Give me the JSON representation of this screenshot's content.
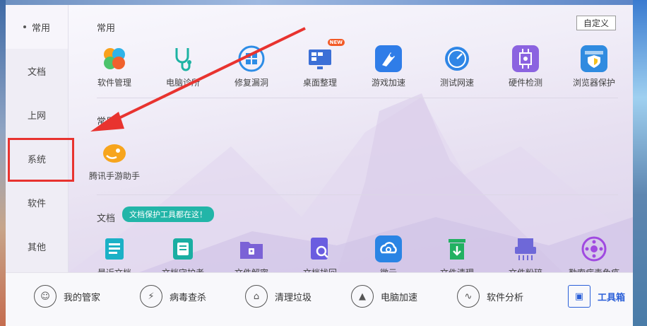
{
  "sidebar": {
    "items": [
      {
        "label": "常用"
      },
      {
        "label": "文档"
      },
      {
        "label": "上网"
      },
      {
        "label": "系统"
      },
      {
        "label": "软件"
      },
      {
        "label": "其他"
      }
    ]
  },
  "header": {
    "customize_label": "自定义"
  },
  "sections": {
    "common": {
      "title": "常用",
      "tools": [
        {
          "label": "软件管理",
          "icon": "software-manager-icon",
          "color": "#f9a11b"
        },
        {
          "label": "电脑诊所",
          "icon": "stethoscope-icon",
          "color": "#1db3a3"
        },
        {
          "label": "修复漏洞",
          "icon": "windows-repair-icon",
          "color": "#2d8de6"
        },
        {
          "label": "桌面整理",
          "icon": "desktop-organize-icon",
          "color": "#3b6fd6",
          "badge": "NEW"
        },
        {
          "label": "游戏加速",
          "icon": "game-boost-icon",
          "color": "#2f7de8"
        },
        {
          "label": "测试网速",
          "icon": "speedometer-icon",
          "color": "#2f86e6"
        },
        {
          "label": "硬件检测",
          "icon": "chip-icon",
          "color": "#8b63e0"
        },
        {
          "label": "浏览器保护",
          "icon": "browser-shield-icon",
          "color": "#2f8be0"
        }
      ]
    },
    "recent": {
      "title": "常用",
      "tools": [
        {
          "label": "腾讯手游助手",
          "icon": "tencent-game-assistant-icon",
          "color": "#f7a51d"
        }
      ]
    },
    "docs": {
      "title": "文档",
      "tooltip": "文档保护工具都在这！",
      "tools": [
        {
          "label": "最近文档",
          "icon": "recent-docs-icon",
          "color": "#1bb1c6"
        },
        {
          "label": "文档守护者",
          "icon": "doc-guardian-icon",
          "color": "#1aaea2"
        },
        {
          "label": "文件解密",
          "icon": "folder-lock-icon",
          "color": "#7b62d6"
        },
        {
          "label": "文档找回",
          "icon": "doc-search-icon",
          "color": "#6a5de0"
        },
        {
          "label": "微云",
          "icon": "weiyun-cloud-icon",
          "color": "#2a84e4"
        },
        {
          "label": "文件清理",
          "icon": "trash-bin-icon",
          "color": "#22b162"
        },
        {
          "label": "文件粉碎",
          "icon": "shredder-icon",
          "color": "#6e68d8"
        },
        {
          "label": "勒索病毒免疫",
          "icon": "virus-immune-icon",
          "color": "#a04ae0"
        }
      ]
    }
  },
  "bottom_nav": [
    {
      "label": "我的管家",
      "icon": "avatar-icon"
    },
    {
      "label": "病毒查杀",
      "icon": "lightning-shield-icon"
    },
    {
      "label": "清理垃圾",
      "icon": "broom-icon"
    },
    {
      "label": "电脑加速",
      "icon": "rocket-icon"
    },
    {
      "label": "软件分析",
      "icon": "analysis-icon"
    },
    {
      "label": "工具箱",
      "icon": "toolbox-icon",
      "active": true
    }
  ],
  "colors": {
    "annotation_red": "#e8332f",
    "accent_blue": "#2a5fd8",
    "tooltip_teal": "#22b5a8"
  }
}
